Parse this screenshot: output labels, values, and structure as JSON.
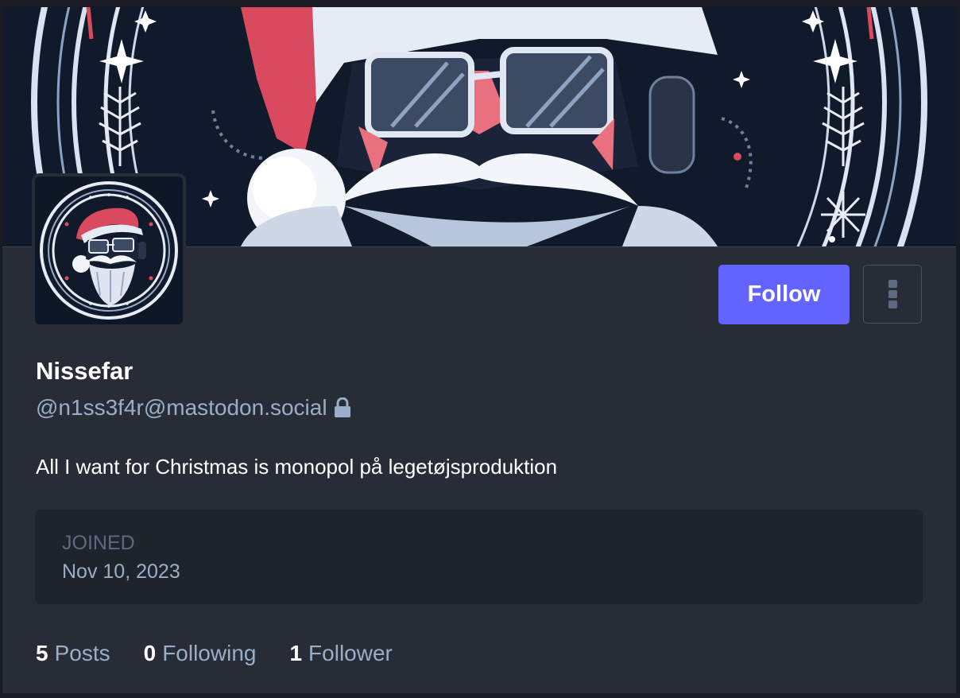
{
  "profile": {
    "display_name": "Nissefar",
    "handle": "@n1ss3f4r@mastodon.social",
    "handle_icon": "lock-icon",
    "bio": "All I want for Christmas is monopol på legetøjsproduktion",
    "follow_label": "Follow",
    "menu_icon": "kebab-menu-icon"
  },
  "fields": {
    "joined_label": "JOINED",
    "joined_value": "Nov 10, 2023"
  },
  "stats": [
    {
      "count": "5",
      "label": "Posts"
    },
    {
      "count": "0",
      "label": "Following"
    },
    {
      "count": "1",
      "label": "Follower"
    }
  ],
  "colors": {
    "accent": "#6364ff",
    "background": "#282c37",
    "muted_text": "#9baec8",
    "banner_red": "#d94a5f"
  }
}
